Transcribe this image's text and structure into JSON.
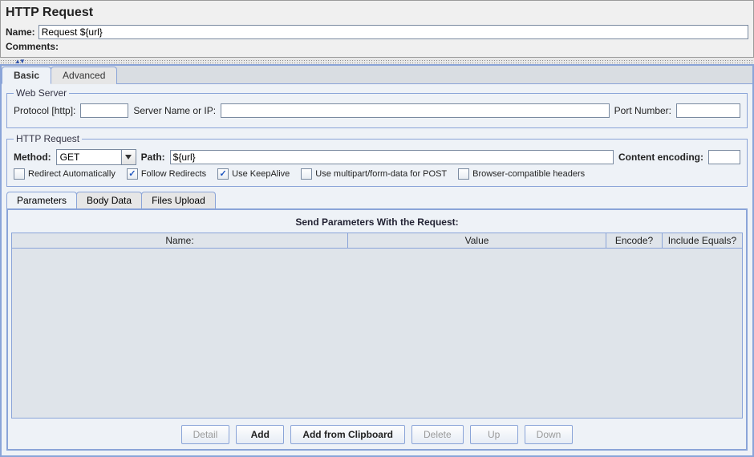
{
  "header": {
    "title": "HTTP Request",
    "name_label": "Name:",
    "name_value": "Request ${url}",
    "comments_label": "Comments:"
  },
  "tabs": {
    "basic": "Basic",
    "advanced": "Advanced"
  },
  "webserver": {
    "legend": "Web Server",
    "protocol_label": "Protocol [http]:",
    "protocol_value": "",
    "server_label": "Server Name or IP:",
    "server_value": "",
    "port_label": "Port Number:",
    "port_value": ""
  },
  "httpreq": {
    "legend": "HTTP Request",
    "method_label": "Method:",
    "method_value": "GET",
    "path_label": "Path:",
    "path_value": "${url}",
    "encoding_label": "Content encoding:",
    "encoding_value": "",
    "cb_redirect_auto": "Redirect Automatically",
    "cb_follow": "Follow Redirects",
    "cb_keepalive": "Use KeepAlive",
    "cb_multipart": "Use multipart/form-data for POST",
    "cb_browser": "Browser-compatible headers"
  },
  "inner_tabs": {
    "parameters": "Parameters",
    "body": "Body Data",
    "files": "Files Upload"
  },
  "params_table": {
    "title": "Send Parameters With the Request:",
    "col_name": "Name:",
    "col_value": "Value",
    "col_encode": "Encode?",
    "col_include": "Include Equals?"
  },
  "buttons": {
    "detail": "Detail",
    "add": "Add",
    "clipboard": "Add from Clipboard",
    "delete": "Delete",
    "up": "Up",
    "down": "Down"
  }
}
